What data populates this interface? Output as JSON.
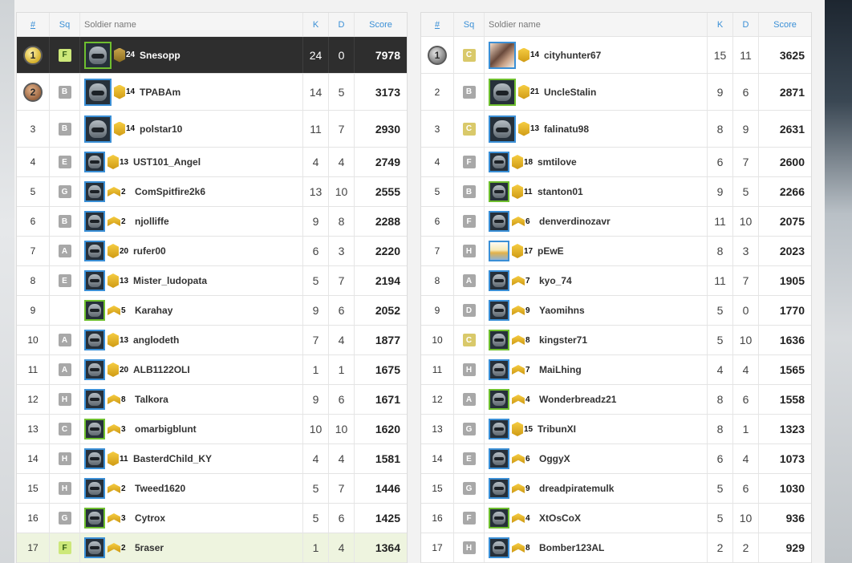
{
  "headers": {
    "rank": "#",
    "squad": "Sq",
    "name": "Soldier name",
    "kills": "K",
    "deaths": "D",
    "score": "Score"
  },
  "colors": {
    "accent_blue": "#3a8fd6",
    "squad_green": "#cde87a",
    "medal_gold": "#d6b12c",
    "highlight_row": "#2e2e2e"
  },
  "left_players": [
    {
      "rank": "1",
      "medal": "gold",
      "squad": "F",
      "squad_style": "mine",
      "avatar": "soldier-avatar",
      "avatar_style": "green",
      "rank_level": "24",
      "name": "Snesopp",
      "kills": "24",
      "deaths": "0",
      "score": "7978",
      "row_style": "top-self"
    },
    {
      "rank": "2",
      "medal": "bronze",
      "squad": "B",
      "avatar": "soldier-avatar",
      "rank_level": "14",
      "name": "TPABAm",
      "kills": "14",
      "deaths": "5",
      "score": "3173"
    },
    {
      "rank": "3",
      "squad": "B",
      "avatar": "soldier-avatar",
      "rank_level": "14",
      "name": "polstar10",
      "kills": "11",
      "deaths": "7",
      "score": "2930"
    },
    {
      "rank": "4",
      "squad": "E",
      "avatar": "soldier-avatar",
      "rank_level": "13",
      "name": "UST101_Angel",
      "kills": "4",
      "deaths": "4",
      "score": "2749"
    },
    {
      "rank": "5",
      "squad": "G",
      "avatar": "soldier-avatar",
      "rank_level": "2",
      "name": "ComSpitfire2k6",
      "kills": "13",
      "deaths": "10",
      "score": "2555"
    },
    {
      "rank": "6",
      "squad": "B",
      "avatar": "soldier-avatar",
      "rank_level": "2",
      "name": "njolliffe",
      "kills": "9",
      "deaths": "8",
      "score": "2288"
    },
    {
      "rank": "7",
      "squad": "A",
      "avatar": "soldier-avatar",
      "rank_level": "20",
      "name": "rufer00",
      "kills": "6",
      "deaths": "3",
      "score": "2220"
    },
    {
      "rank": "8",
      "squad": "E",
      "avatar": "soldier-avatar",
      "rank_level": "13",
      "name": "Mister_ludopata",
      "kills": "5",
      "deaths": "7",
      "score": "2194"
    },
    {
      "rank": "9",
      "squad": "",
      "avatar": "soldier-avatar",
      "avatar_style": "green",
      "rank_level": "5",
      "name": "Karahay",
      "kills": "9",
      "deaths": "6",
      "score": "2052"
    },
    {
      "rank": "10",
      "squad": "A",
      "avatar": "soldier-avatar",
      "rank_level": "13",
      "name": "anglodeth",
      "kills": "7",
      "deaths": "4",
      "score": "1877"
    },
    {
      "rank": "11",
      "squad": "A",
      "avatar": "soldier-avatar",
      "rank_level": "20",
      "name": "ALB1122OLI",
      "kills": "1",
      "deaths": "1",
      "score": "1675"
    },
    {
      "rank": "12",
      "squad": "H",
      "avatar": "soldier-avatar",
      "rank_level": "8",
      "name": "Talkora",
      "kills": "9",
      "deaths": "6",
      "score": "1671"
    },
    {
      "rank": "13",
      "squad": "C",
      "avatar": "soldier-avatar",
      "avatar_style": "green",
      "rank_level": "3",
      "name": "omarbigblunt",
      "kills": "10",
      "deaths": "10",
      "score": "1620"
    },
    {
      "rank": "14",
      "squad": "H",
      "avatar": "soldier-avatar",
      "rank_level": "11",
      "name": "BasterdChild_KY",
      "kills": "4",
      "deaths": "4",
      "score": "1581"
    },
    {
      "rank": "15",
      "squad": "H",
      "avatar": "soldier-avatar",
      "rank_level": "2",
      "name": "Tweed1620",
      "kills": "5",
      "deaths": "7",
      "score": "1446"
    },
    {
      "rank": "16",
      "squad": "G",
      "avatar": "soldier-avatar",
      "avatar_style": "green",
      "rank_level": "3",
      "name": "Cytrox",
      "kills": "5",
      "deaths": "6",
      "score": "1425"
    },
    {
      "rank": "17",
      "squad": "F",
      "squad_style": "mine",
      "avatar": "soldier-avatar",
      "rank_level": "2",
      "name": "5raser",
      "kills": "1",
      "deaths": "4",
      "score": "1364",
      "row_style": "hl"
    }
  ],
  "right_players": [
    {
      "rank": "1",
      "medal": "silver",
      "squad": "C",
      "squad_style": "yellow",
      "avatar": "photo-avatar",
      "rank_level": "14",
      "name": "cityhunter67",
      "kills": "15",
      "deaths": "11",
      "score": "3625"
    },
    {
      "rank": "2",
      "squad": "B",
      "avatar": "soldier-avatar",
      "avatar_style": "green",
      "rank_level": "21",
      "name": "UncleStalin",
      "kills": "9",
      "deaths": "6",
      "score": "2871"
    },
    {
      "rank": "3",
      "squad": "C",
      "squad_style": "yellow",
      "avatar": "soldier-avatar",
      "rank_level": "13",
      "name": "falinatu98",
      "kills": "8",
      "deaths": "9",
      "score": "2631"
    },
    {
      "rank": "4",
      "squad": "F",
      "avatar": "soldier-avatar",
      "rank_level": "18",
      "name": "smtilove",
      "kills": "6",
      "deaths": "7",
      "score": "2600"
    },
    {
      "rank": "5",
      "squad": "B",
      "avatar": "soldier-avatar",
      "avatar_style": "green",
      "rank_level": "11",
      "name": "stanton01",
      "kills": "9",
      "deaths": "5",
      "score": "2266"
    },
    {
      "rank": "6",
      "squad": "F",
      "avatar": "soldier-avatar",
      "rank_level": "6",
      "name": "denverdinozavr",
      "kills": "11",
      "deaths": "10",
      "score": "2075"
    },
    {
      "rank": "7",
      "squad": "H",
      "avatar": "food-avatar",
      "rank_level": "17",
      "name": "pEwE",
      "kills": "8",
      "deaths": "3",
      "score": "2023"
    },
    {
      "rank": "8",
      "squad": "A",
      "avatar": "soldier-avatar",
      "rank_level": "7",
      "name": "kyo_74",
      "kills": "11",
      "deaths": "7",
      "score": "1905"
    },
    {
      "rank": "9",
      "squad": "D",
      "avatar": "soldier-avatar",
      "rank_level": "9",
      "name": "Yaomihns",
      "kills": "5",
      "deaths": "0",
      "score": "1770"
    },
    {
      "rank": "10",
      "squad": "C",
      "squad_style": "yellow",
      "avatar": "soldier-avatar",
      "avatar_style": "green",
      "rank_level": "8",
      "name": "kingster71",
      "kills": "5",
      "deaths": "10",
      "score": "1636"
    },
    {
      "rank": "11",
      "squad": "H",
      "avatar": "soldier-avatar",
      "rank_level": "7",
      "name": "MaiLhing",
      "kills": "4",
      "deaths": "4",
      "score": "1565"
    },
    {
      "rank": "12",
      "squad": "A",
      "avatar": "soldier-avatar",
      "avatar_style": "green",
      "rank_level": "4",
      "name": "Wonderbreadz21",
      "kills": "8",
      "deaths": "6",
      "score": "1558"
    },
    {
      "rank": "13",
      "squad": "G",
      "avatar": "soldier-avatar",
      "rank_level": "15",
      "name": "TribunXI",
      "kills": "8",
      "deaths": "1",
      "score": "1323"
    },
    {
      "rank": "14",
      "squad": "E",
      "avatar": "soldier-avatar",
      "rank_level": "6",
      "name": "OggyX",
      "kills": "6",
      "deaths": "4",
      "score": "1073"
    },
    {
      "rank": "15",
      "squad": "G",
      "avatar": "soldier-avatar",
      "rank_level": "9",
      "name": "dreadpiratemulk",
      "kills": "5",
      "deaths": "6",
      "score": "1030"
    },
    {
      "rank": "16",
      "squad": "F",
      "avatar": "soldier-avatar",
      "avatar_style": "green",
      "rank_level": "4",
      "name": "XtOsCoX",
      "kills": "5",
      "deaths": "10",
      "score": "936"
    },
    {
      "rank": "17",
      "squad": "H",
      "avatar": "soldier-avatar",
      "rank_level": "8",
      "name": "Bomber123AL",
      "kills": "2",
      "deaths": "2",
      "score": "929"
    }
  ]
}
